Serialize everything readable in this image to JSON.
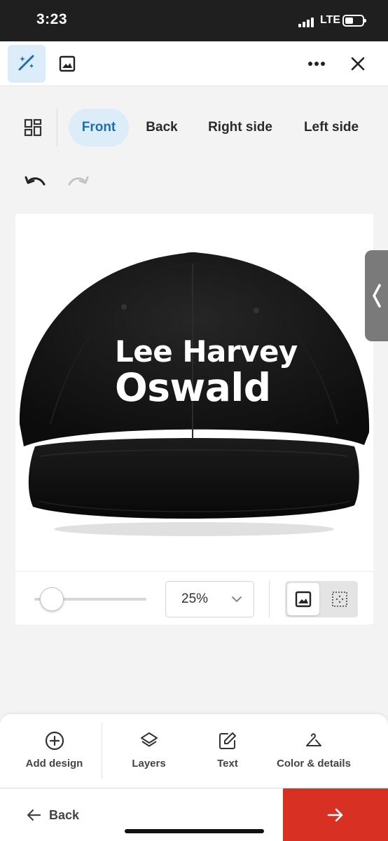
{
  "status_bar": {
    "time": "3:23",
    "network": "LTE",
    "icons": [
      "signal-icon",
      "battery-icon"
    ]
  },
  "toolbar": {
    "left_icons": [
      "magic-wand-icon",
      "image-icon"
    ],
    "right_icons": [
      "more-icon",
      "close-icon"
    ]
  },
  "sides": {
    "grid_icon": "grid-view-icon",
    "tabs": [
      {
        "label": "Front",
        "active": true
      },
      {
        "label": "Back",
        "active": false
      },
      {
        "label": "Right side",
        "active": false
      },
      {
        "label": "Left side",
        "active": false
      }
    ]
  },
  "history": {
    "undo_icon": "undo-icon",
    "redo_icon": "redo-icon"
  },
  "canvas": {
    "product": "black snapback cap",
    "design_text": {
      "line1": "Lee Harvey",
      "line2": "Oswald"
    }
  },
  "zoom": {
    "level": "25%",
    "slider_value": 0.25,
    "view_modes": [
      {
        "icon": "image-view-icon",
        "active": true
      },
      {
        "icon": "dotted-grid-icon",
        "active": false
      }
    ]
  },
  "actions": [
    {
      "label": "Add design",
      "icon": "add-circle-icon"
    },
    {
      "label": "Layers",
      "icon": "layers-icon"
    },
    {
      "label": "Text",
      "icon": "edit-text-icon"
    },
    {
      "label": "Color & details",
      "icon": "hanger-icon"
    }
  ],
  "footer": {
    "back_label": "Back",
    "next_icon": "arrow-right-icon"
  },
  "colors": {
    "accent": "#1d6fb0",
    "tab_active_bg": "#dcecf8",
    "next_button": "#d93024",
    "cap": "#121212"
  }
}
